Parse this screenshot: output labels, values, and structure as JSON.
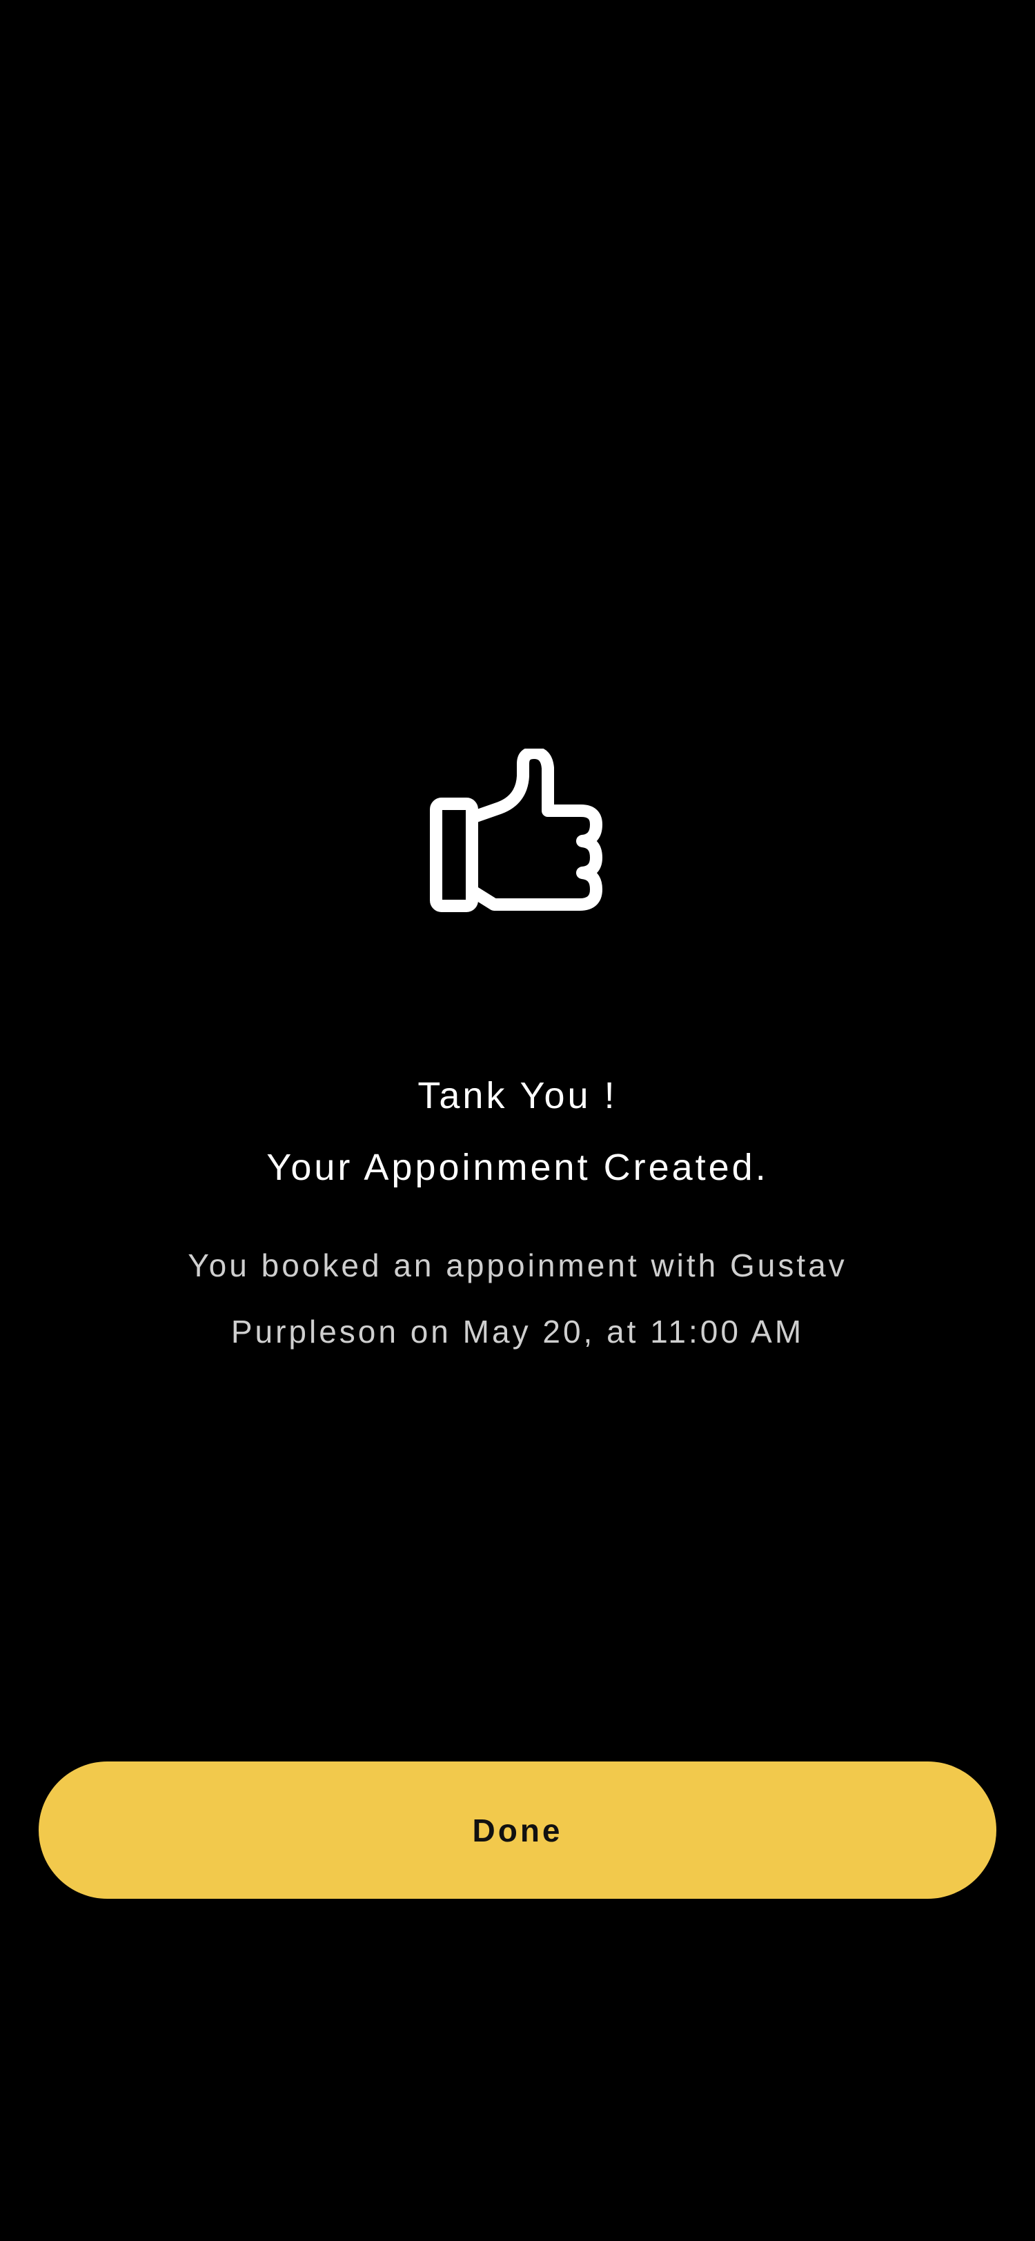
{
  "confirmation": {
    "icon": "thumbs-up-icon",
    "title_line_1": "Tank You !",
    "title_line_2": "Your Appoinment Created.",
    "message_line_1": "You booked an appoinment with Gustav",
    "message_line_2": "Purpleson on May 20, at 11:00 AM"
  },
  "actions": {
    "done_label": "Done"
  },
  "colors": {
    "background": "#000000",
    "accent": "#F2C94C",
    "title_text": "#FFFFFF",
    "message_text": "#CFCFCF",
    "button_text": "#111111"
  }
}
